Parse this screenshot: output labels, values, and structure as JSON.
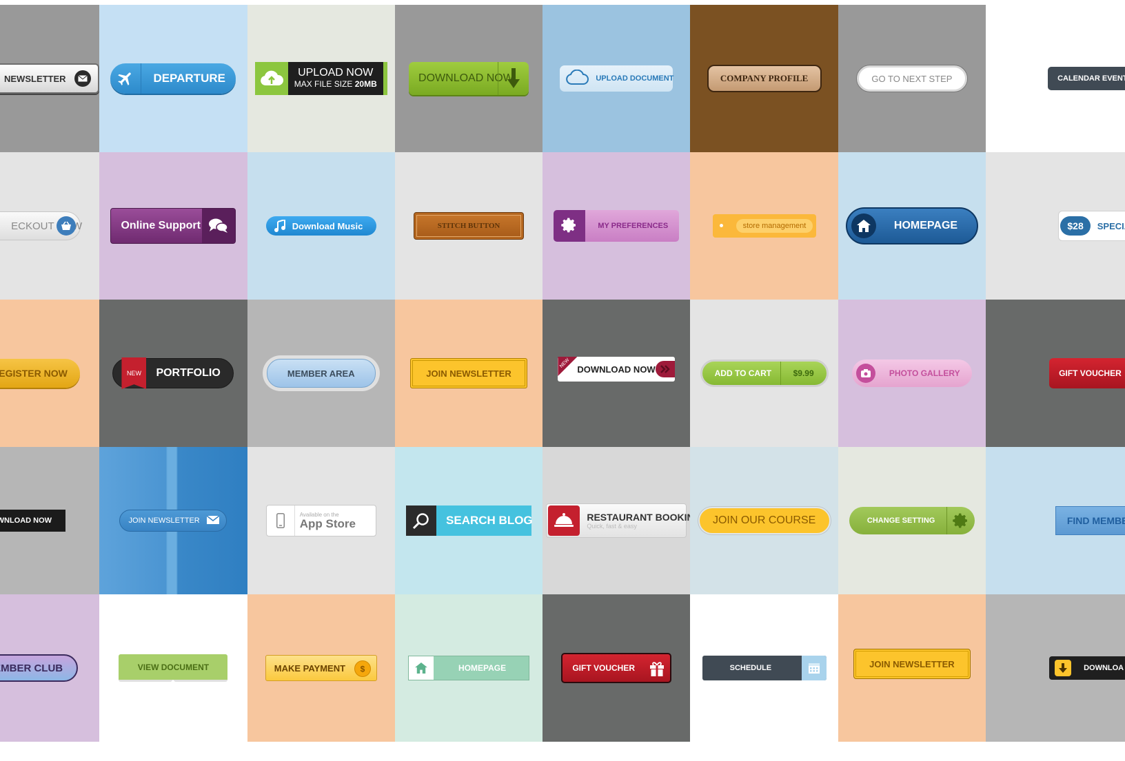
{
  "buttons": {
    "newsletter": "NEWSLETTER",
    "departure": "DEPARTURE",
    "upload_now": "UPLOAD NOW",
    "max_file_size": "MAX FILE SIZE",
    "max_file_size_value": "20MB",
    "download_now_green": "DOWNLOAD NOW",
    "upload_document": "UPLOAD DOCUMENT",
    "company_profile": "COMPANY PROFILE",
    "go_to_next_step": "GO TO NEXT STEP",
    "calendar_event": "CALENDAR EVENT",
    "checkout_now": "ECKOUT NOW",
    "online_support": "Online Support",
    "download_music": "Download Music",
    "stitch_button": "STITCH BUTTON",
    "my_preferences": "MY PREFERENCES",
    "store_management": "store management",
    "homepage_blue": "HOMEPAGE",
    "special_price": "$28",
    "special_label": "SPECIAL",
    "register_now": "REGISTER NOW",
    "portfolio_badge": "NEW",
    "portfolio": "PORTFOLIO",
    "member_area": "MEMBER AREA",
    "join_newsletter_yellow": "JOIN NEWSLETTER",
    "download_now_badge": "NEW",
    "download_now_white": "DOWNLOAD NOW",
    "add_to_cart": "ADD TO CART",
    "cart_price": "$9.99",
    "photo_gallery": "PHOTO GALLERY",
    "gift_voucher_side": "GIFT VOUCHER",
    "download_now_black": "DOWNLOAD NOW",
    "join_newsletter_blue": "JOIN NEWSLETTER",
    "app_store_small": "Available on the",
    "app_store": "App Store",
    "search_blog": "SEARCH BLOG",
    "restaurant_booking": "RESTAURANT BOOKING",
    "restaurant_sub": "Quick, fast & easy",
    "join_our_course": "JOIN OUR COURSE",
    "change_setting": "CHANGE SETTING",
    "find_member": "FIND MEMBER",
    "member_club": "EMBER CLUB",
    "view_document": "VIEW DOCUMENT",
    "make_payment": "MAKE PAYMENT",
    "homepage_mint": "HOMEPAGE",
    "gift_voucher": "GIFT VOUCHER",
    "schedule": "SCHEDULE",
    "join_newsletter_outline": "JOIN NEWSLETTER",
    "download_dark": "DOWNLOA"
  },
  "icons": {
    "newsletter": "envelope-icon",
    "departure": "airplane-icon",
    "upload_now": "cloud-upload-icon",
    "download_now_green": "arrow-down-icon",
    "upload_document": "cloud-icon",
    "checkout_now": "basket-icon",
    "online_support": "chat-bubbles-icon",
    "download_music": "music-note-icon",
    "my_preferences": "gear-icon",
    "homepage_blue": "home-icon",
    "download_now_white": "double-chevron-icon",
    "photo_gallery": "camera-icon",
    "join_newsletter_blue": "envelope-icon",
    "app_store": "phone-icon",
    "search_blog": "search-icon",
    "restaurant_booking": "cloche-icon",
    "change_setting": "gear-icon",
    "make_payment": "coin-icon",
    "homepage_mint": "home-icon",
    "gift_voucher": "gift-icon",
    "schedule": "calendar-icon",
    "download_dark": "arrow-down-icon"
  },
  "colors": {
    "tile_gray": "#999999",
    "tile_blue_light": "#c5e0f4",
    "tile_brown": "#7b5122",
    "tile_lilac": "#d6bfdd",
    "tile_peach": "#f7c69e",
    "tile_dark": "#686a69",
    "accent_blue": "#3b9ddc",
    "accent_green": "#8fbe3c",
    "accent_red": "#c4202e",
    "accent_yellow": "#fcc42c"
  }
}
